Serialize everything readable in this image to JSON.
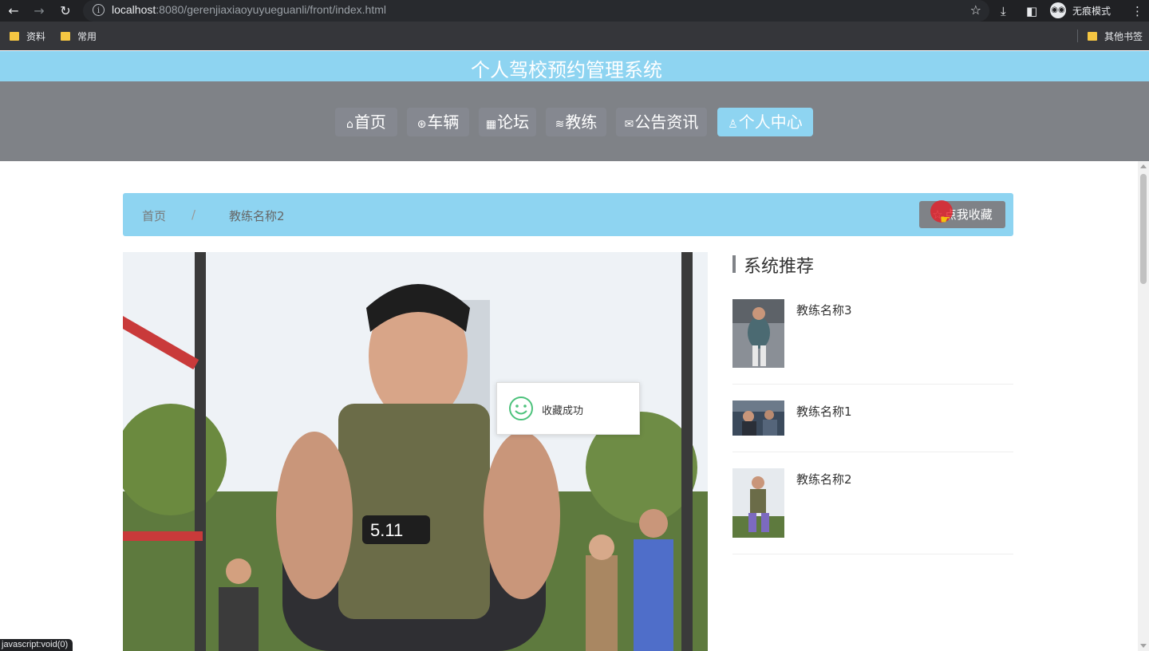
{
  "browser": {
    "url_host": "localhost",
    "url_rest": ":8080/gerenjiaxiaoyuyueguanli/front/index.html",
    "incognito_label": "无痕模式",
    "status_text": "javascript:void(0)"
  },
  "bookmarks": {
    "items": [
      {
        "label": "资料"
      },
      {
        "label": "常用"
      }
    ],
    "other": "其他书签"
  },
  "site": {
    "title": "个人驾校预约管理系统",
    "theme_color": "#8ed4f1",
    "nav_color": "#7f8287"
  },
  "nav": {
    "items": [
      {
        "label": "首页",
        "icon": "home-icon"
      },
      {
        "label": "车辆",
        "icon": "car-icon"
      },
      {
        "label": "论坛",
        "icon": "forum-icon"
      },
      {
        "label": "教练",
        "icon": "coach-icon"
      },
      {
        "label": "公告资讯",
        "icon": "mail-icon"
      },
      {
        "label": "个人中心",
        "icon": "user-icon",
        "active": true
      }
    ]
  },
  "breadcrumb": {
    "home": "首页",
    "separator": "/",
    "current": "教练名称2",
    "collect_button": "点我收藏"
  },
  "recommend": {
    "title": "系统推荐",
    "items": [
      {
        "name": "教练名称3"
      },
      {
        "name": "教练名称1"
      },
      {
        "name": "教练名称2"
      }
    ]
  },
  "toast": {
    "message": "收藏成功"
  }
}
